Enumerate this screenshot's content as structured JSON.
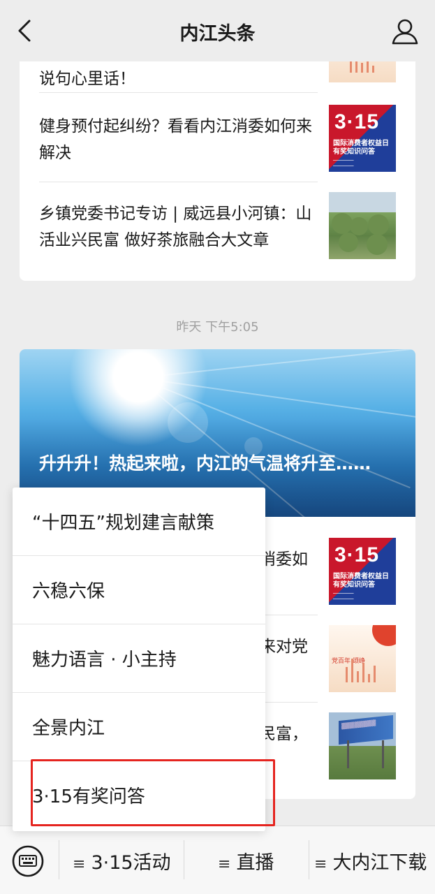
{
  "header": {
    "title": "内江头条"
  },
  "card1": {
    "rows": [
      {
        "title": "说句心里话！"
      },
      {
        "title": "健身预付起纠纷？看看内江消委如何来解决"
      },
      {
        "title": "乡镇党委书记专访 | 威远县小河镇：山活业兴民富 做好茶旅融合大文章"
      }
    ]
  },
  "thumb_315": {
    "big": "3·15",
    "line1": "国际消费者权益日",
    "line2": "有奖知识问答"
  },
  "thumb_party": {
    "text": "党百年  颂峥"
  },
  "timestamp": "昨天 下午5:05",
  "card2": {
    "headline": "升升升！热起来啦，内江的气温将升至……",
    "rows": [
      {
        "title_tail": "消委如"
      },
      {
        "title_tail": "来对党"
      },
      {
        "title_tail": "民富，"
      }
    ]
  },
  "popup_menu": {
    "items": [
      {
        "label": "“十四五”规划建言献策"
      },
      {
        "label": "六稳六保"
      },
      {
        "label": "魅力语言 · 小主持"
      },
      {
        "label": "全景内江"
      },
      {
        "label": "3·15有奖问答"
      }
    ],
    "highlighted_index": 4,
    "highlight_color": "#e5241f"
  },
  "bottom_menu": {
    "items": [
      {
        "label": "3·15活动"
      },
      {
        "label": "直播"
      },
      {
        "label": "大内江下载"
      }
    ]
  },
  "icons": {
    "back": "back-chevron-icon",
    "profile": "profile-person-icon",
    "keyboard": "keyboard-icon",
    "menu": "menu-lines-icon"
  }
}
